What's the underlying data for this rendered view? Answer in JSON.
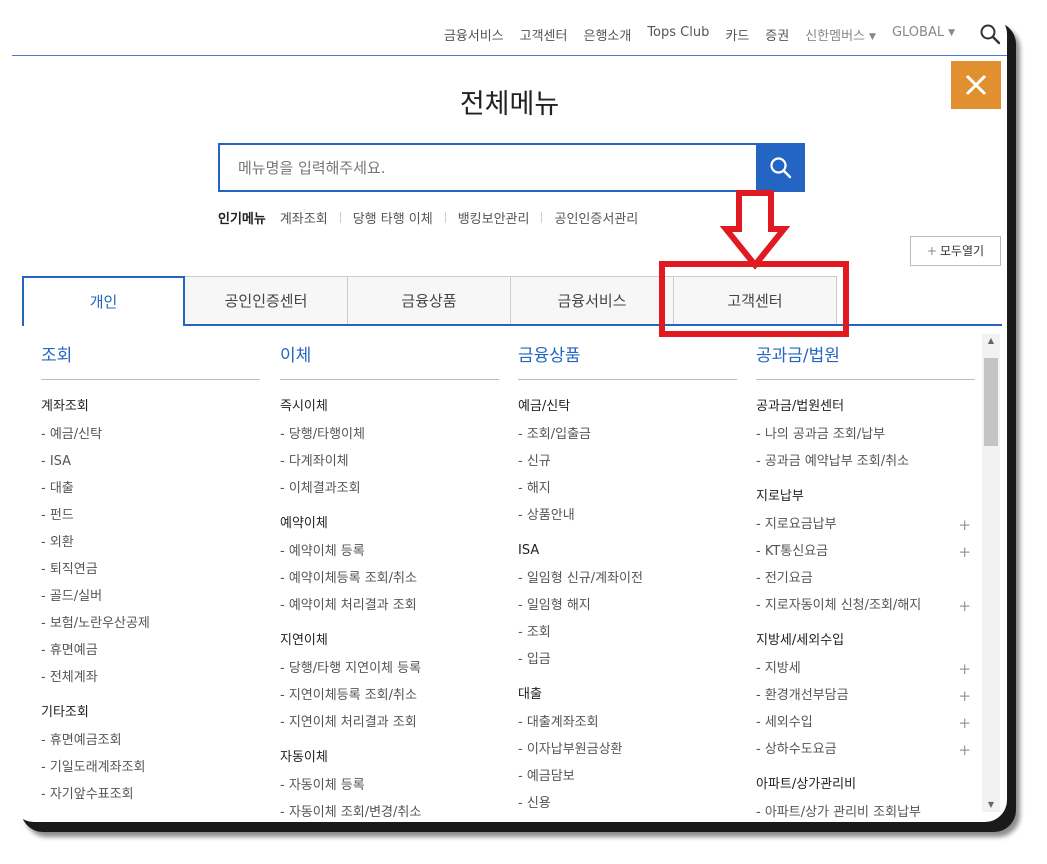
{
  "topnav": {
    "items": [
      "금융서비스",
      "고객센터",
      "은행소개",
      "Tops Club",
      "카드",
      "증권"
    ],
    "members": "신한멤버스",
    "global": "GLOBAL"
  },
  "page_title": "전체메뉴",
  "search": {
    "placeholder": "메뉴명을 입력해주세요."
  },
  "popular": {
    "label": "인기메뉴",
    "items": [
      "계좌조회",
      "당행 타행 이체",
      "뱅킹보안관리",
      "공인인증서관리"
    ]
  },
  "expand_all": "모두열기",
  "tabs": [
    "개인",
    "공인인증센터",
    "금융상품",
    "금융서비스",
    "고객센터"
  ],
  "columns": [
    {
      "title": "조회",
      "groups": [
        {
          "head": "계좌조회",
          "links": [
            "- 예금/신탁",
            "- ISA",
            "- 대출",
            "- 펀드",
            "- 외환",
            "- 퇴직연금",
            "- 골드/실버",
            "- 보험/노란우산공제",
            "- 휴면예금",
            "- 전체계좌"
          ]
        },
        {
          "head": "기타조회",
          "links": [
            "- 휴면예금조회",
            "- 기일도래계좌조회",
            "- 자기앞수표조회"
          ]
        }
      ]
    },
    {
      "title": "이체",
      "groups": [
        {
          "head": "즉시이체",
          "links": [
            "- 당행/타행이체",
            "- 다계좌이체",
            "- 이체결과조회"
          ]
        },
        {
          "head": "예약이체",
          "links": [
            "- 예약이체 등록",
            "- 예약이체등록 조회/취소",
            "- 예약이체 처리결과 조회"
          ]
        },
        {
          "head": "지연이체",
          "links": [
            "- 당행/타행 지연이체 등록",
            "- 지연이체등록 조회/취소",
            "- 지연이체 처리결과 조회"
          ]
        },
        {
          "head": "자동이체",
          "links": [
            "- 자동이체 등록",
            "- 자동이체 조회/변경/취소"
          ]
        }
      ]
    },
    {
      "title": "금융상품",
      "groups": [
        {
          "head": "예금/신탁",
          "links": [
            "- 조회/입출금",
            "- 신규",
            "- 해지",
            "- 상품안내"
          ]
        },
        {
          "head": "ISA",
          "links": [
            "- 일임형 신규/계좌이전",
            "- 일임형 해지",
            "- 조회",
            "- 입금"
          ]
        },
        {
          "head": "대출",
          "links": [
            "- 대출계좌조회",
            "- 이자납부원금상환",
            "- 예금담보",
            "- 신용"
          ]
        }
      ]
    },
    {
      "title": "공과금/법원",
      "groups": [
        {
          "head": "공과금/법원센터",
          "links": [
            "- 나의 공과금 조회/납부",
            "- 공과금 예약납부 조회/취소"
          ]
        },
        {
          "head": "지로납부",
          "links": [
            "- 지로요금납부",
            "- KT통신요금",
            "- 전기요금",
            "- 지로자동이체 신청/조회/해지"
          ]
        },
        {
          "head": "지방세/세외수입",
          "links": [
            "- 지방세",
            "- 환경개선부담금",
            "- 세외수입",
            "- 상하수도요금"
          ]
        },
        {
          "head": "아파트/상가관리비",
          "links": [
            "- 아파트/상가 관리비 조회납부"
          ]
        }
      ]
    }
  ],
  "plus_rows": [
    "- 지로요금납부",
    "- KT통신요금",
    "- 지로자동이체 신청/조회/해지",
    "- 지방세",
    "- 환경개선부담금",
    "- 세외수입",
    "- 상하수도요금"
  ],
  "colors": {
    "accent": "#2465c3",
    "close_bg": "#e0902f",
    "annotation": "#e01a20"
  }
}
